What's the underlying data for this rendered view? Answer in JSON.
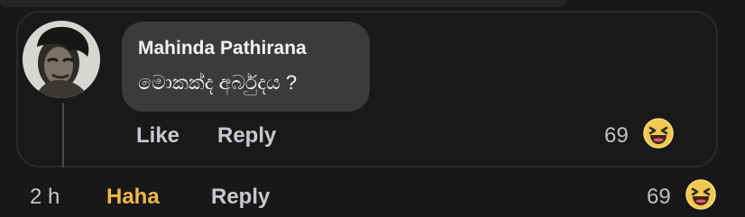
{
  "reply": {
    "author_name": "Mahinda Pathirana",
    "text": "මොකක්ද අර්බුදය ?",
    "actions": {
      "like": "Like",
      "reply": "Reply"
    },
    "reaction_count": "69"
  },
  "parent": {
    "timestamp": "2 h",
    "reaction_label": "Haha",
    "reply_label": "Reply",
    "reaction_count": "69"
  },
  "colors": {
    "background": "#18181a",
    "bubble": "#3a3b3d",
    "haha": "#f0b94b"
  },
  "icons": {
    "reaction": "laughing-face-icon"
  }
}
